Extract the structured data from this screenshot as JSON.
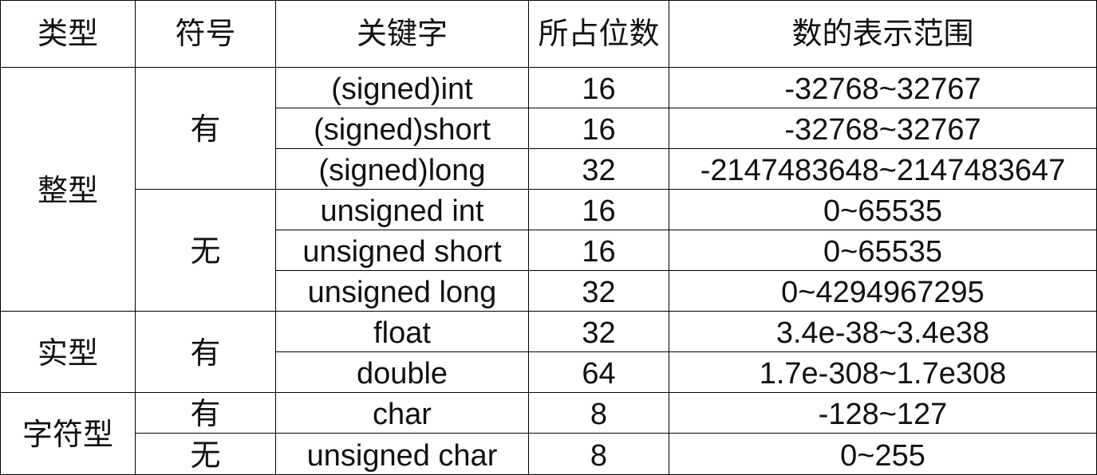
{
  "table": {
    "headers": {
      "type": "类型",
      "sign": "符号",
      "keyword": "关键字",
      "bits": "所占位数",
      "range": "数的表示范围"
    },
    "types": [
      "整型",
      "实型",
      "字符型"
    ],
    "signs": [
      "有",
      "无",
      "有",
      "有",
      "无"
    ],
    "rows": [
      {
        "keyword": "(signed)int",
        "bits": "16",
        "range": "-32768~32767"
      },
      {
        "keyword": "(signed)short",
        "bits": "16",
        "range": "-32768~32767"
      },
      {
        "keyword": "(signed)long",
        "bits": "32",
        "range": "-2147483648~2147483647"
      },
      {
        "keyword": "unsigned int",
        "bits": "16",
        "range": "0~65535"
      },
      {
        "keyword": "unsigned short",
        "bits": "16",
        "range": "0~65535"
      },
      {
        "keyword": "unsigned long",
        "bits": "32",
        "range": "0~4294967295"
      },
      {
        "keyword": "float",
        "bits": "32",
        "range": "3.4e-38~3.4e38"
      },
      {
        "keyword": "double",
        "bits": "64",
        "range": "1.7e-308~1.7e308"
      },
      {
        "keyword": "char",
        "bits": "8",
        "range": "-128~127"
      },
      {
        "keyword": "unsigned char",
        "bits": "8",
        "range": "0~255"
      }
    ]
  }
}
